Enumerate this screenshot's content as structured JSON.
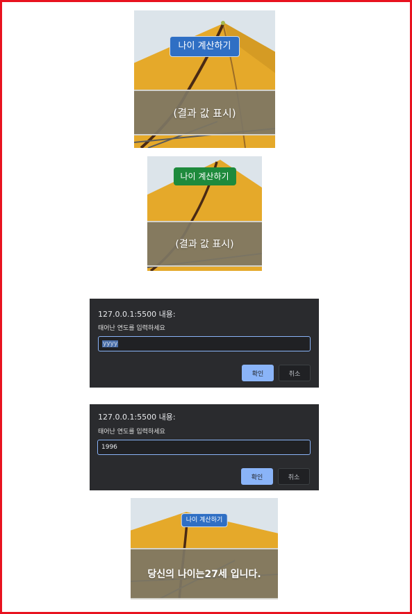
{
  "panels": [
    {
      "button_label": "나이 계산하기",
      "button_color": "#2f6fc4",
      "band_text": "(결과 값 표시)"
    },
    {
      "button_label": "나이 계산하기",
      "button_color": "#1e8a3c",
      "band_text": "(결과 값 표시)"
    },
    {
      "button_label": "나이 계산하기",
      "button_color": "#2f6fc4",
      "band_text": "당신의 나이는27세 입니다."
    }
  ],
  "dialogs": [
    {
      "origin": "127.0.0.1:5500 내용:",
      "message": "태어난 연도를 입력하세요",
      "input_value": "yyyy",
      "ok_label": "확인",
      "cancel_label": "취소"
    },
    {
      "origin": "127.0.0.1:5500 내용:",
      "message": "태어난 연도를 입력하세요",
      "input_value": "1996",
      "ok_label": "확인",
      "cancel_label": "취소"
    }
  ],
  "colors": {
    "frame": "#e8121f",
    "umbrella": "#e5a92a",
    "dialog_bg": "#2a2b2e",
    "ok_button": "#8ab4f8"
  }
}
